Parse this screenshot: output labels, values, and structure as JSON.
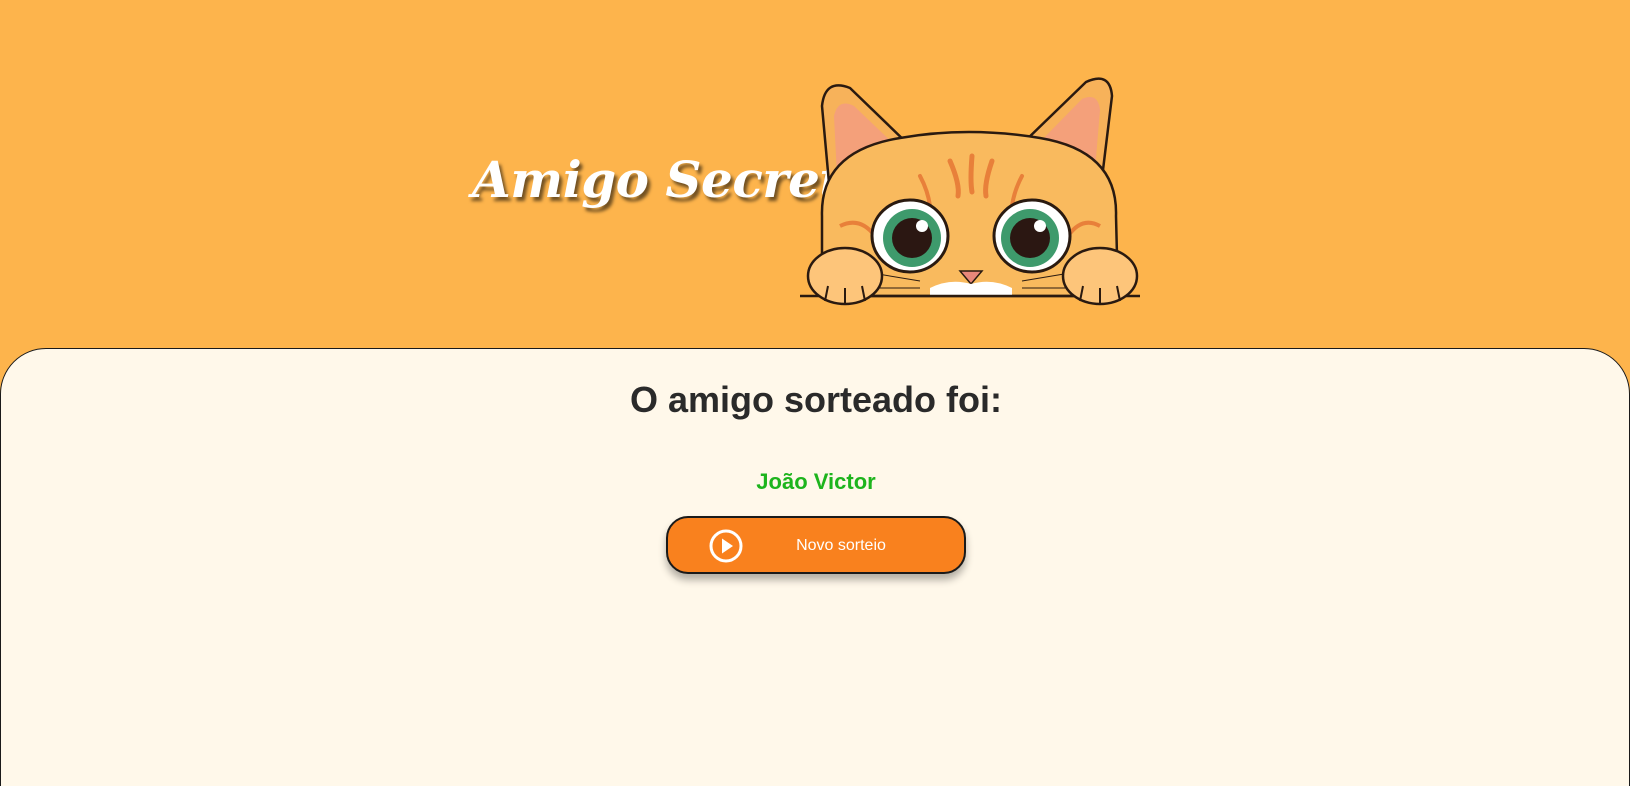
{
  "header": {
    "title": "Amigo Secreto",
    "mascot_icon": "cat-peeking-icon",
    "background_color": "#FDB44C"
  },
  "main": {
    "result_title": "O amigo sorteado foi:",
    "result_name": "João Victor",
    "name_color": "#1DB41D",
    "background_color": "#FFF8EA",
    "draw_button": {
      "label": "Novo sorteio",
      "icon": "play-circle-icon",
      "color": "#F9811E"
    }
  }
}
